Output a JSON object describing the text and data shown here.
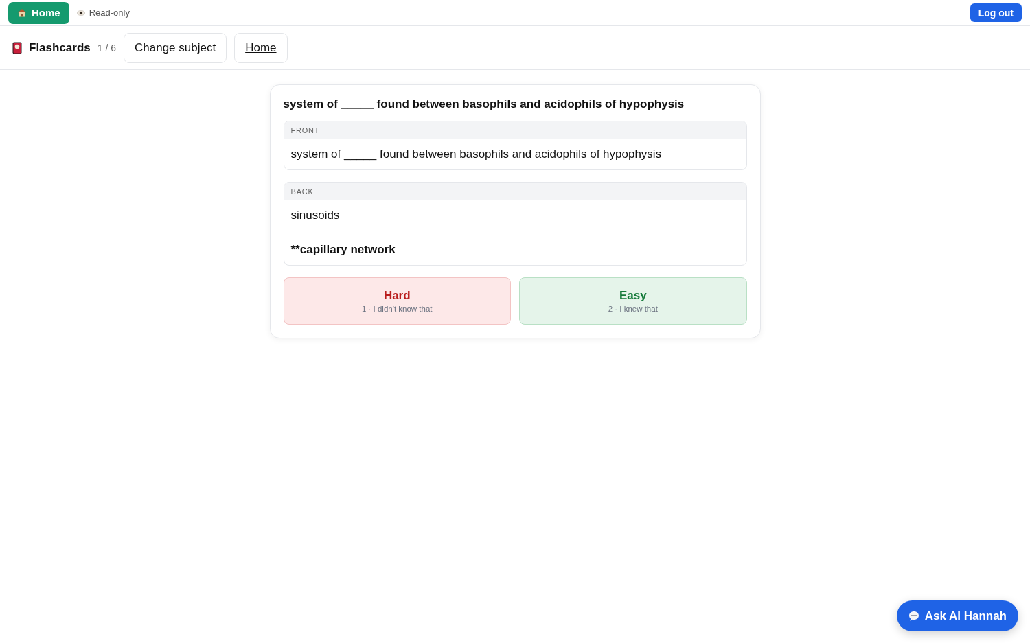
{
  "topbar": {
    "home_button": "Home",
    "mode": "Read-only",
    "logout_button": "Log out"
  },
  "header": {
    "title": "Flashcards",
    "counter": "1 / 6",
    "buttons": [
      {
        "label": "Change subject",
        "kind": "plain"
      },
      {
        "label": "Home",
        "kind": "link"
      }
    ]
  },
  "card": {
    "title": "system of _____ found between basophils and acidophils of hypophysis",
    "sections": [
      {
        "label": "FRONT",
        "lines": [
          {
            "text": "system of _____ found between basophils and acidophils of hypophysis",
            "bold": false
          }
        ]
      },
      {
        "label": "BACK",
        "lines": [
          {
            "text": "sinusoids",
            "bold": false
          },
          {
            "text": "**capillary network",
            "bold": true
          }
        ]
      }
    ],
    "ratings": [
      {
        "kind": "hard",
        "label": "Hard",
        "hint": "1 · I didn't know that"
      },
      {
        "kind": "easy",
        "label": "Easy",
        "hint": "2 · I knew that"
      }
    ]
  },
  "chat_button": "Ask AI Hannah"
}
